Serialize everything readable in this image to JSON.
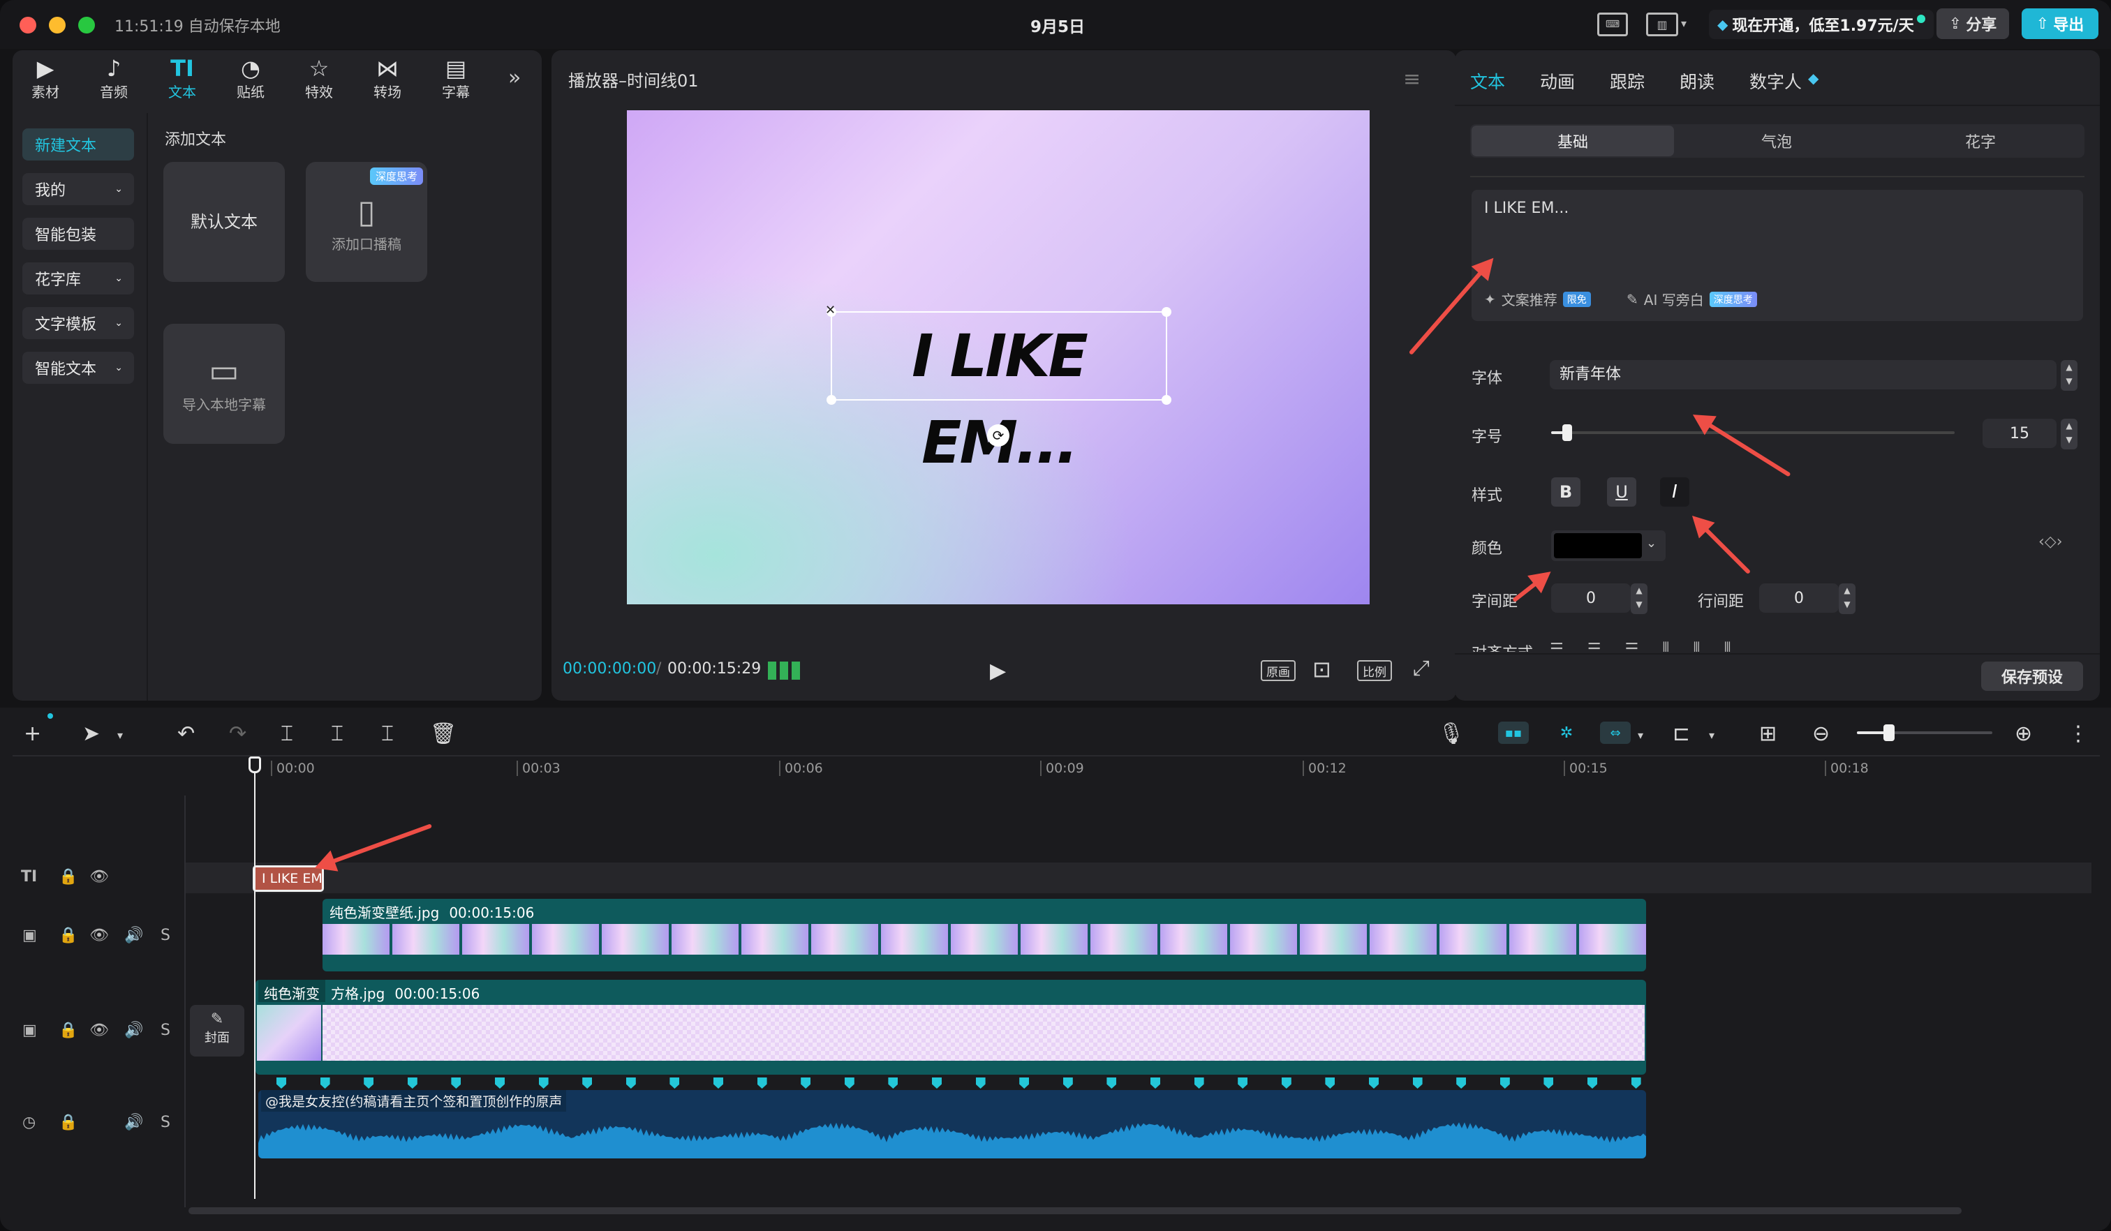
{
  "titlebar": {
    "save_status": "11:51:19 自动保存本地",
    "date": "9月5日",
    "promo": "现在开通，低至1.97元/天",
    "share": "分享",
    "export": "导出"
  },
  "left_tabs": [
    {
      "label": "素材",
      "icon": "media-icon"
    },
    {
      "label": "音频",
      "icon": "audio-icon"
    },
    {
      "label": "文本",
      "icon": "text-icon"
    },
    {
      "label": "贴纸",
      "icon": "sticker-icon"
    },
    {
      "label": "特效",
      "icon": "effects-icon"
    },
    {
      "label": "转场",
      "icon": "transition-icon"
    },
    {
      "label": "字幕",
      "icon": "subtitle-icon"
    }
  ],
  "sidebar": [
    {
      "label": "新建文本"
    },
    {
      "label": "我的"
    },
    {
      "label": "智能包装"
    },
    {
      "label": "花字库"
    },
    {
      "label": "文字模板"
    },
    {
      "label": "智能文本"
    }
  ],
  "text_panel": {
    "heading": "添加文本",
    "default_text": "默认文本",
    "add_script": "添加口播稿",
    "badge_deep": "深度思考",
    "import_subtitle": "导入本地字幕"
  },
  "player": {
    "title": "播放器–时间线01",
    "preview_text": "I LIKE EM...",
    "time_current": "00:00:00:00",
    "time_total": "00:00:15:29",
    "btn_original": "原画",
    "btn_ratio": "比例"
  },
  "inspector": {
    "tabs": [
      "文本",
      "动画",
      "跟踪",
      "朗读",
      "数字人"
    ],
    "subtabs": [
      "基础",
      "气泡",
      "花字"
    ],
    "text_value": "I LIKE EM...",
    "copy_suggest": "文案推荐",
    "badge_free": "限免",
    "ai_write": "AI 写旁白",
    "badge_deep": "深度思考",
    "font_label": "字体",
    "font_value": "新青年体",
    "size_label": "字号",
    "size_value": "15",
    "style_label": "样式",
    "color_label": "颜色",
    "color_value": "#000000",
    "letter_spacing_label": "字间距",
    "letter_spacing_value": "0",
    "line_spacing_label": "行间距",
    "line_spacing_value": "0",
    "align_label": "对齐方式",
    "save_preset": "保存预设"
  },
  "timeline": {
    "ticks": [
      "00:00",
      "00:03",
      "00:06",
      "00:09",
      "00:12",
      "00:15",
      "00:18"
    ],
    "text_clip": "I LIKE EM",
    "clip1_name": "纯色渐变壁纸.jpg",
    "clip1_dur": "00:00:15:06",
    "clip2_a": "纯色渐变",
    "clip2_name": "方格.jpg",
    "clip2_dur": "00:00:15:06",
    "cover": "封面",
    "audio_name": "@我是女友控(约稿请看主页个签和置顶创作的原声"
  }
}
